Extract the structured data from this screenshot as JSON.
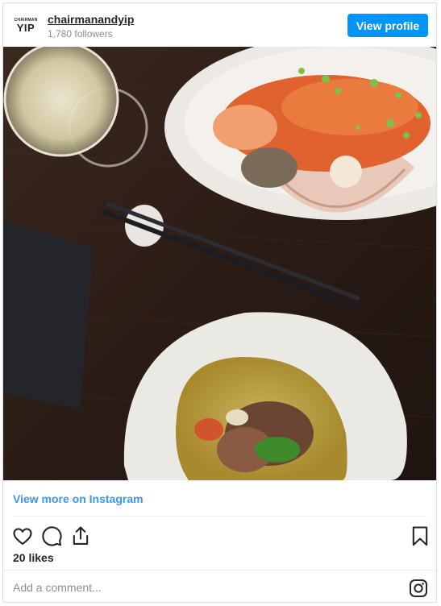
{
  "account": {
    "avatar_small_text": "CHAIRMAN",
    "avatar_big_text": "YIP",
    "username": "chairmanandyip",
    "followers": "1,780 followers",
    "view_profile_label": "View profile"
  },
  "post": {
    "view_more_label": "View more on Instagram",
    "likes": "20 likes",
    "comment_placeholder": "Add a comment..."
  },
  "icons": {
    "like": "heart-icon",
    "comment": "comment-icon",
    "share": "share-icon",
    "save": "bookmark-icon",
    "brand": "instagram-icon"
  },
  "colors": {
    "accent": "#0095f6",
    "link": "#3897f0",
    "text": "#262626",
    "muted": "#8e8e8e"
  }
}
